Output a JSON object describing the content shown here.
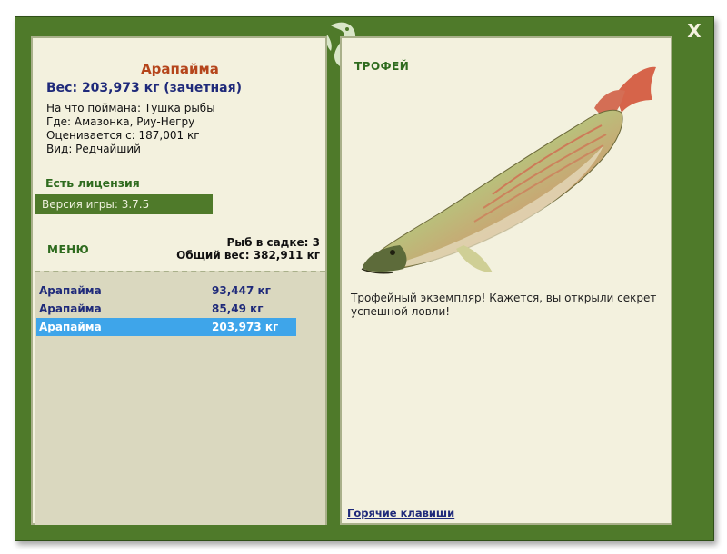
{
  "window": {
    "close_label": "X"
  },
  "fish": {
    "name": "Арапайма",
    "weight_line": "Вес: 203,973 кг (зачетная)",
    "bait": "На что поймана: Тушка рыбы",
    "location": "Где: Амазонка, Риу-Негру",
    "rated_from": "Оценивается с: 187,001 кг",
    "rarity": "Вид: Редчайший"
  },
  "license_label": "Есть лицензия",
  "version_label": "Версия игры: 3.7.5",
  "menu_label": "МЕНЮ",
  "keepnet": {
    "count_line": "Рыб в садке: 3",
    "total_line": "Общий вес: 382,911 кг"
  },
  "catch_list": [
    {
      "name": "Арапайма",
      "weight": "93,447 кг",
      "selected": false
    },
    {
      "name": "Арапайма",
      "weight": "85,49 кг",
      "selected": false
    },
    {
      "name": "Арапайма",
      "weight": "203,973 кг",
      "selected": true
    }
  ],
  "trophy_label": "ТРОФЕЙ",
  "trophy_text": "Трофейный экземпляр! Кажется, вы открыли секрет успешной ловли!",
  "hotkeys_label": "Горячие клавиши",
  "colors": {
    "frame": "#4f7a2a",
    "panel": "#f3f1de",
    "list_bg": "#dad8bf",
    "selected_row": "#3ea5ea",
    "fish_name": "#b5451b",
    "weight_text": "#1f2a7a",
    "green_heading": "#2e6b1e"
  },
  "icons": {
    "logo": "fish-logo-icon",
    "close": "close-icon",
    "fish_image": "arapaima-image"
  }
}
